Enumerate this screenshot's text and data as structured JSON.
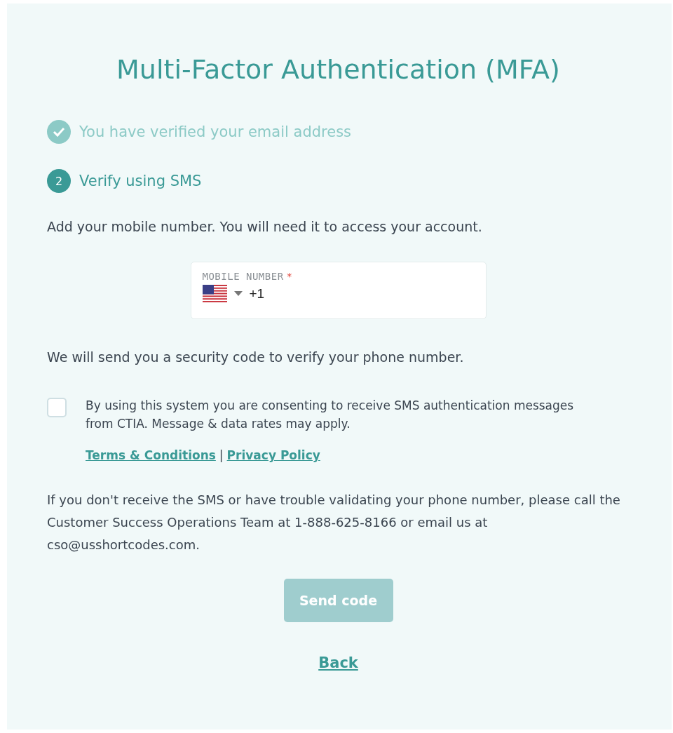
{
  "title": "Multi-Factor Authentication (MFA)",
  "steps": [
    {
      "kind": "done",
      "label": "You have verified your email address"
    },
    {
      "kind": "current",
      "number": "2",
      "label": "Verify using SMS"
    }
  ],
  "intro": "Add your mobile number. You will need it to access your account.",
  "phone_field": {
    "label": "MOBILE NUMBER",
    "required_mark": "*",
    "value": "+1"
  },
  "send_note": "We will send you a security code to verify your phone number.",
  "consent": {
    "checked": false,
    "text": "By using this system you are consenting to receive SMS authentication messages from CTIA. Message & data rates may apply."
  },
  "links": [
    "Terms & Conditions",
    "Privacy Policy"
  ],
  "link_separator": "|",
  "help": "If you don't receive the SMS or have trouble validating your phone number, please call the Customer Success Operations Team at 1-888-625-8166 or email us at cso@usshortcodes.com.",
  "send_button": {
    "label": "Send code",
    "disabled": true
  },
  "back_link": "Back"
}
